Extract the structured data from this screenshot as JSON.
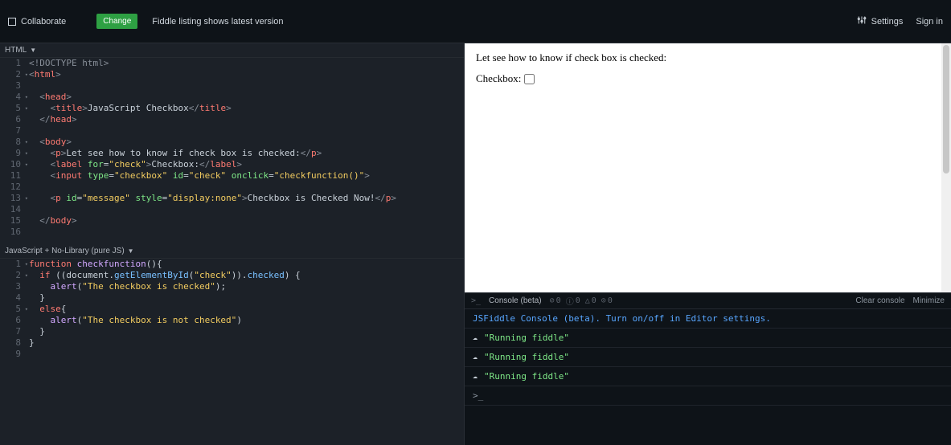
{
  "topbar": {
    "collaborate": "Collaborate",
    "change_label": "Change",
    "listing_text": "Fiddle listing shows latest version",
    "settings": "Settings",
    "signin": "Sign in"
  },
  "panes": {
    "html_label": "HTML",
    "js_label": "JavaScript + No-Library (pure JS)"
  },
  "html_lines": {
    "l1_doc": "<!DOCTYPE html>",
    "l2_open": "<",
    "l2_tag": "html",
    "l2_close": ">",
    "l4_head_open": "<",
    "l4_head": "head",
    "l4_head_close": ">",
    "l5_title_o": "<",
    "l5_title": "title",
    "l5_title_oc": ">",
    "l5_txt": "JavaScript Checkbox",
    "l5_title_c": "</",
    "l5_title2": "title",
    "l5_title_cc": ">",
    "l6_head_c": "</",
    "l6_head": "head",
    "l6_head_cc": ">",
    "l8_body_o": "<",
    "l8_body": "body",
    "l8_body_oc": ">",
    "l9_p_o": "<",
    "l9_p": "p",
    "l9_p_oc": ">",
    "l9_txt": "Let see how to know if check box is checked:",
    "l9_p_c": "</",
    "l9_p2": "p",
    "l9_p_cc": ">",
    "l10_lbl_o": "<",
    "l10_lbl": "label",
    "l10_sp": " ",
    "l10_attr": "for",
    "l10_eq": "=",
    "l10_val": "\"check\"",
    "l10_lbl_oc": ">",
    "l10_txt": "Checkbox:",
    "l10_lbl_c": "</",
    "l10_lbl2": "label",
    "l10_lbl_cc": ">",
    "l11_in_o": "<",
    "l11_in": "input",
    "l11_a1": "type",
    "l11_v1": "\"checkbox\"",
    "l11_a2": "id",
    "l11_v2": "\"check\"",
    "l11_a3": "onclick",
    "l11_v3": "\"checkfunction()\"",
    "l11_close": ">",
    "l13_p_o": "<",
    "l13_p": "p",
    "l13_a1": "id",
    "l13_v1": "\"message\"",
    "l13_a2": "style",
    "l13_v2": "\"display:none\"",
    "l13_oc": ">",
    "l13_txt": "Checkbox is Checked Now!",
    "l13_c": "</",
    "l13_p2": "p",
    "l13_cc": ">",
    "l15_body_c": "</",
    "l15_body": "body",
    "l15_body_cc": ">"
  },
  "js_lines": {
    "l1_kw": "function",
    "l1_fn": "checkfunction",
    "l1_rest": "(){",
    "l2_kw": "if",
    "l2_rest1": " ((document.",
    "l2_fn": "getElementById",
    "l2_paren_o": "(",
    "l2_str": "\"check\"",
    "l2_rest2": ")).",
    "l2_prop": "checked",
    "l2_rest3": ") {",
    "l3_fn": "alert",
    "l3_paren_o": "(",
    "l3_str": "\"The checkbox is checked\"",
    "l3_rest": ");",
    "l4": "  }",
    "l5_kw": "else",
    "l5_rest": "{",
    "l6_fn": "alert",
    "l6_paren_o": "(",
    "l6_str": "\"The checkbox is not checked\"",
    "l6_rest": ")",
    "l7": "  }",
    "l8": "}"
  },
  "preview": {
    "p1": "Let see how to know if check box is checked:",
    "label": "Checkbox:"
  },
  "console": {
    "title": "Console (beta)",
    "counters": [
      "0",
      "0",
      "0",
      "0"
    ],
    "clear": "Clear console",
    "minimize": "Minimize",
    "info_msg": "JSFiddle Console (beta). Turn on/off in Editor settings.",
    "run_msg": "\"Running fiddle\"",
    "prompt": ">_"
  },
  "line_numbers": {
    "html": [
      "1",
      "2",
      "3",
      "4",
      "5",
      "6",
      "7",
      "8",
      "9",
      "10",
      "11",
      "12",
      "13",
      "14",
      "15",
      "16"
    ],
    "js": [
      "1",
      "2",
      "3",
      "4",
      "5",
      "6",
      "7",
      "8",
      "9"
    ]
  }
}
